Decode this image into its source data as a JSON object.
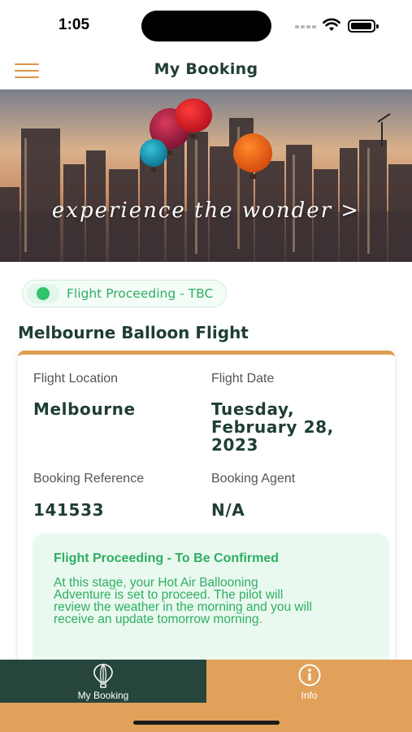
{
  "status_bar": {
    "time": "1:05",
    "icons": [
      "signal-icon",
      "wifi-icon",
      "battery-icon"
    ]
  },
  "header": {
    "title": "My Booking",
    "menu_icon": "hamburger-menu-icon"
  },
  "banner": {
    "tagline": "experience the wonder >"
  },
  "status": {
    "label": "Flight Proceeding - TBC",
    "color": "#2fc46a"
  },
  "flight": {
    "title": "Melbourne Balloon Flight"
  },
  "details": {
    "location_label": "Flight Location",
    "location_value": "Melbourne",
    "date_label": "Flight Date",
    "date_lines": [
      "Tuesday,",
      "February 28,",
      "2023"
    ],
    "reference_label": "Booking Reference",
    "reference_value": "141533",
    "agent_label": "Booking Agent",
    "agent_value": "N/A"
  },
  "notice": {
    "title": "Flight Proceeding - To Be Confirmed",
    "body_lines": [
      "At this stage, your Hot Air Ballooning",
      "Adventure is set to proceed. The pilot will",
      "review the weather in the morning and you will",
      "receive an update tomorrow morning."
    ]
  },
  "tabs": [
    {
      "label": "My Booking",
      "icon": "hot-air-balloon-icon",
      "active": true
    },
    {
      "label": "Info",
      "icon": "info-icon",
      "active": false
    }
  ],
  "colors": {
    "brand_dark_green": "#26463d",
    "accent_orange": "#e1a15a",
    "status_green": "#2fae62",
    "notice_bg": "#e9f9ef"
  }
}
